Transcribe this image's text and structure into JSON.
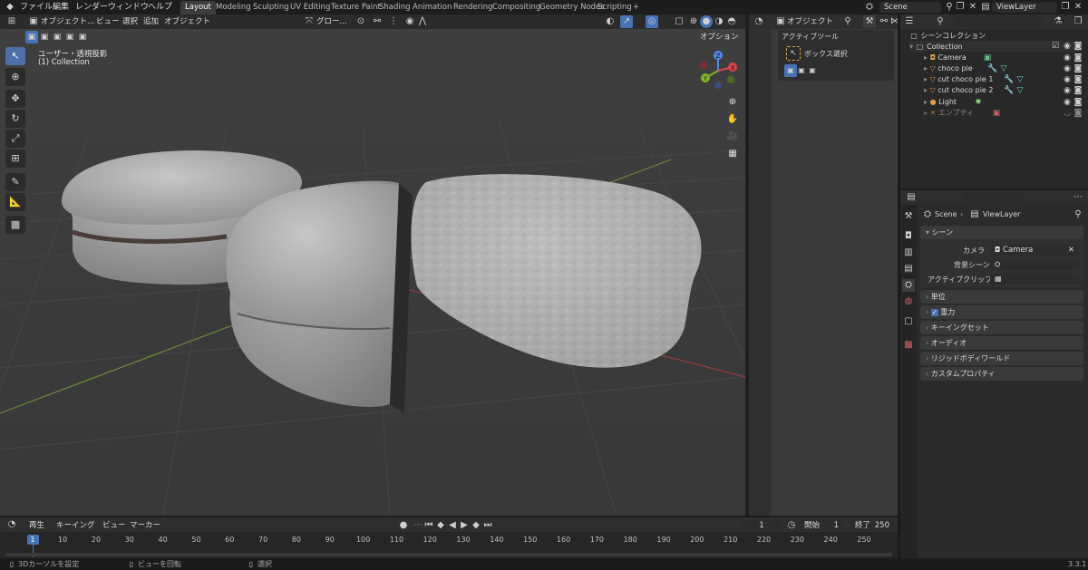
{
  "topbar": {
    "menus": [
      "ファイル",
      "編集",
      "レンダー",
      "ウィンドウ",
      "ヘルプ"
    ],
    "workspaces": [
      "Layout",
      "Modeling",
      "Sculpting",
      "UV Editing",
      "Texture Paint",
      "Shading",
      "Animation",
      "Rendering",
      "Compositing",
      "Geometry Nodes",
      "Scripting"
    ],
    "active_workspace": "Layout",
    "add_tab": "+",
    "scene": "Scene",
    "view_layer": "ViewLayer"
  },
  "viewport": {
    "mode": "オブジェクト...",
    "menus": [
      "ビュー",
      "選択",
      "追加",
      "オブジェクト"
    ],
    "transform_orientation": "グロー...",
    "options": "オプション",
    "view_name": "ユーザー・透視投影",
    "collection_label": "(1) Collection",
    "gizmo_axes": [
      "X",
      "Y",
      "Z"
    ]
  },
  "midpanel": {
    "mode": "オブジェクト",
    "section_title": "アクティブツール",
    "tool_name": "ボックス選択"
  },
  "outliner": {
    "title": "シーンコレクション",
    "collection": "Collection",
    "items": [
      {
        "name": "Camera",
        "icon": "camera-icon"
      },
      {
        "name": "choco pie",
        "icon": "mesh-icon"
      },
      {
        "name": "cut choco pie 1",
        "icon": "mesh-icon"
      },
      {
        "name": "cut choco pie 2",
        "icon": "mesh-icon"
      },
      {
        "name": "Light",
        "icon": "light-icon"
      },
      {
        "name": "エンプティ",
        "icon": "empty-icon"
      }
    ]
  },
  "properties": {
    "breadcrumb_scene": "Scene",
    "breadcrumb_layer": "ViewLayer",
    "scene_section": "シーン",
    "camera_label": "カメラ",
    "camera_value": "Camera",
    "background_label": "背景シーン",
    "clip_label": "アクティブクリップ",
    "sections": [
      "単位",
      "重力",
      "キーイングセット",
      "オーディオ",
      "リジッドボディワールド",
      "カスタムプロパティ"
    ],
    "gravity_checked": true
  },
  "timeline": {
    "menus": [
      "再生",
      "キーイング",
      "ビュー",
      "マーカー"
    ],
    "current_frame": "1",
    "start_label": "開始",
    "start_value": "1",
    "end_label": "終了",
    "end_value": "250",
    "ticks": [
      "1",
      "10",
      "20",
      "30",
      "40",
      "50",
      "60",
      "70",
      "80",
      "90",
      "100",
      "110",
      "120",
      "130",
      "140",
      "150",
      "160",
      "170",
      "180",
      "190",
      "200",
      "210",
      "220",
      "230",
      "240",
      "250"
    ]
  },
  "statusbar": {
    "left": "3Dカーソルを設定",
    "middle": "ビューを回転",
    "right": "選択",
    "version": "3.3.1"
  },
  "colors": {
    "accent_blue": "#4772b3",
    "x_axis": "#e0444b",
    "y_axis": "#82b52a",
    "z_axis": "#4f88ee"
  }
}
